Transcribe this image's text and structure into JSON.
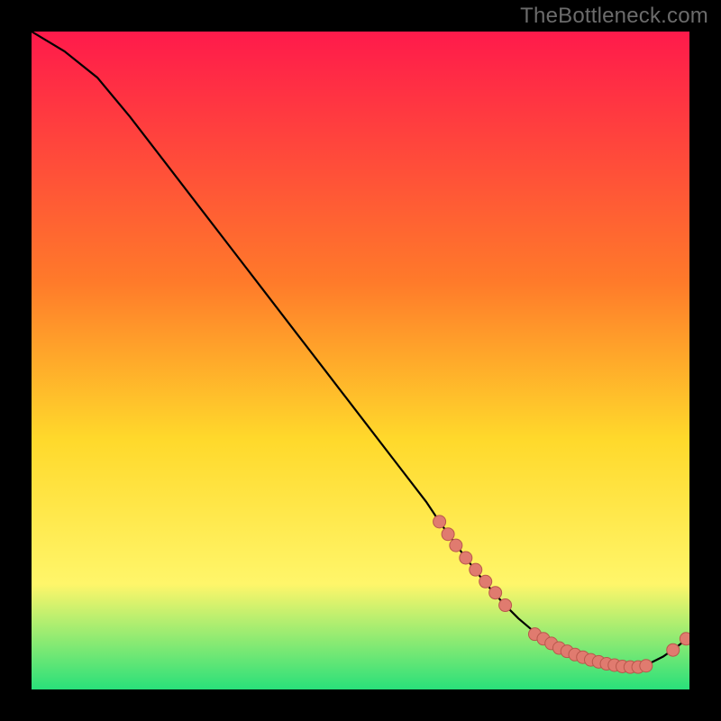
{
  "watermark": "TheBottleneck.com",
  "colors": {
    "grad_top": "#ff1a4b",
    "grad_mid1": "#ff7a2a",
    "grad_mid2": "#ffd92b",
    "grad_mid3": "#fff66a",
    "grad_bot": "#29e07a",
    "marker_fill": "#e07b6f",
    "marker_stroke": "#b9584c",
    "line": "#000000"
  },
  "chart_data": {
    "type": "line",
    "title": "",
    "xlabel": "",
    "ylabel": "",
    "xlim": [
      0,
      100
    ],
    "ylim": [
      0,
      100
    ],
    "series": [
      {
        "name": "curve",
        "x": [
          0,
          5,
          10,
          15,
          20,
          25,
          30,
          35,
          40,
          45,
          50,
          55,
          60,
          62,
          64,
          66,
          68,
          70,
          72,
          74,
          76,
          78,
          80,
          82,
          84,
          86,
          88,
          90,
          92,
          94,
          96,
          98,
          100
        ],
        "y": [
          100,
          97,
          93,
          87,
          80.5,
          74,
          67.5,
          61,
          54.5,
          48,
          41.5,
          35,
          28.5,
          25.5,
          22.7,
          20,
          17.4,
          15,
          12.8,
          10.8,
          9.1,
          7.6,
          6.3,
          5.3,
          4.5,
          3.9,
          3.5,
          3.3,
          3.4,
          4.0,
          5.0,
          6.4,
          8.0
        ]
      }
    ],
    "marker_groups": [
      {
        "name": "descent-markers",
        "x": [
          62,
          63.3,
          64.5,
          66,
          67.5,
          69,
          70.5,
          72
        ],
        "y": [
          25.5,
          23.6,
          21.9,
          20,
          18.2,
          16.4,
          14.7,
          12.8
        ]
      },
      {
        "name": "flat-markers",
        "x": [
          76.5,
          77.8,
          79,
          80.2,
          81.4,
          82.6,
          83.8,
          85,
          86.2,
          87.4,
          88.6,
          89.8,
          91,
          92.2,
          93.4
        ],
        "y": [
          8.4,
          7.7,
          7.0,
          6.3,
          5.8,
          5.3,
          4.9,
          4.5,
          4.2,
          3.9,
          3.7,
          3.5,
          3.4,
          3.4,
          3.6
        ]
      },
      {
        "name": "rise-markers",
        "x": [
          97.5,
          99.5
        ],
        "y": [
          6.0,
          7.7
        ]
      }
    ]
  }
}
